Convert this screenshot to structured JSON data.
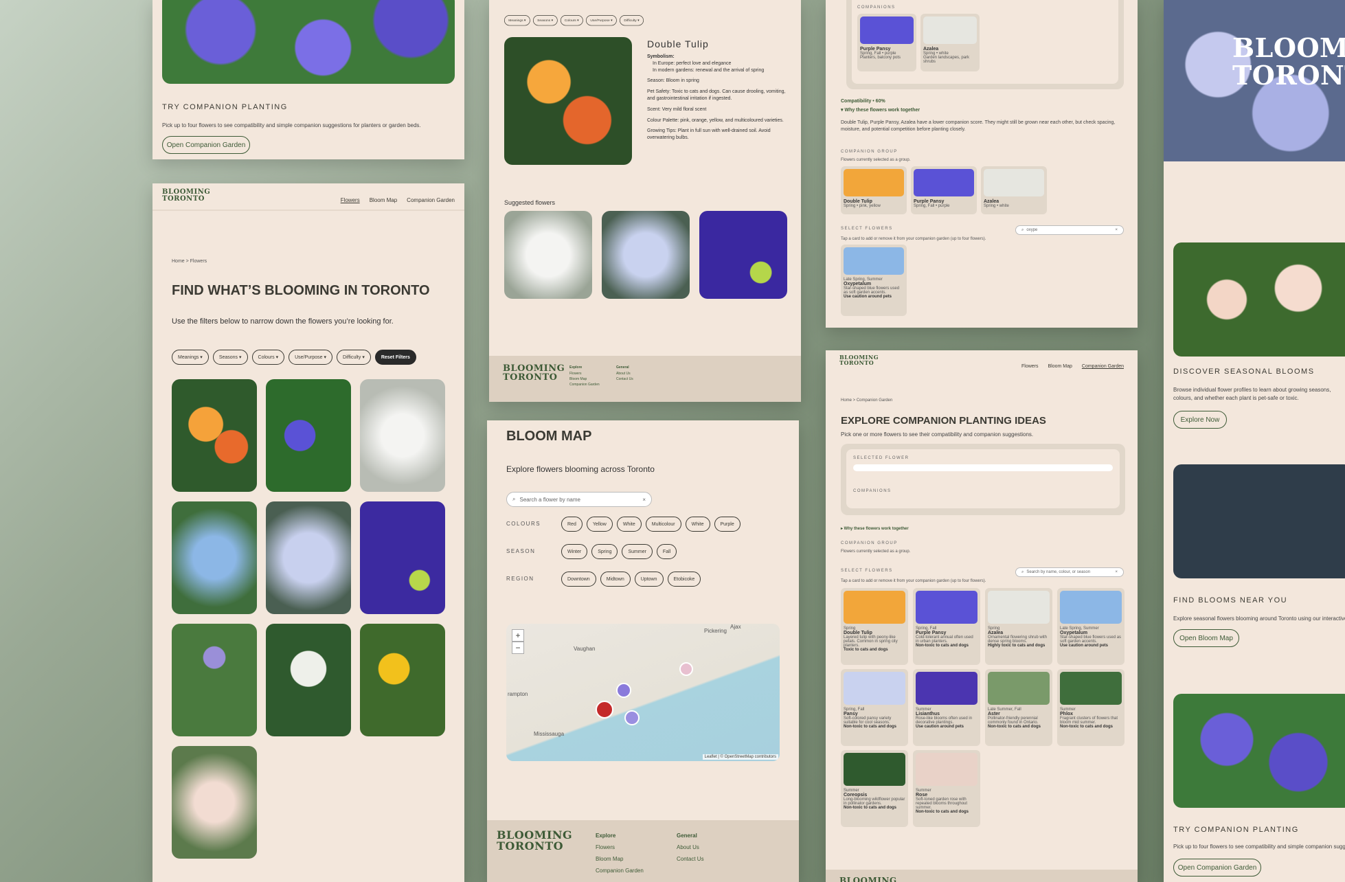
{
  "brand": {
    "line1": "BLOOMING",
    "line2": "TORONTO"
  },
  "nav": {
    "flowers": "Flowers",
    "bloom_map": "Bloom Map",
    "companion": "Companion Garden"
  },
  "panelA": {
    "heading": "TRY COMPANION PLANTING",
    "text": "Pick up to four flowers to see compatibility and simple companion suggestions for planters or garden beds.",
    "button": "Open Companion Garden"
  },
  "flowers_page": {
    "breadcrumb": "Home > Flowers",
    "title": "FIND WHAT’S BLOOMING IN TORONTO",
    "subtitle": "Use the filters below to narrow down the flowers you’re looking for.",
    "filters": [
      "Meanings ▾",
      "Seasons ▾",
      "Colours ▾",
      "Use/Purpose ▾",
      "Difficulty ▾"
    ],
    "reset": "Reset Filters"
  },
  "detail": {
    "filters": [
      "Meanings ▾",
      "Seasons ▾",
      "Colours ▾",
      "Use/Purpose ▾",
      "Difficulty ▾"
    ],
    "name": "Double Tulip",
    "symbolism_label": "Symbolism:",
    "symbolism": [
      "In Europe: perfect love and elegance",
      "In modern gardens: renewal and the arrival of spring"
    ],
    "season": "Season: Bloom in spring",
    "pet": "Pet Safety: Toxic to cats and dogs. Can cause drooling, vomiting, and gastrointestinal irritation if ingested.",
    "scent": "Scent: Very mild floral scent",
    "palette": "Colour Palette: pink, orange, yellow, and multicoloured varieties.",
    "tips": "Growing Tips: Plant in full sun with well-drained soil. Avoid overwatering bulbs.",
    "suggested": "Suggested flowers"
  },
  "footer": {
    "explore": "Explore",
    "general": "General",
    "links_explore": [
      "Flowers",
      "Bloom Map",
      "Companion Garden"
    ],
    "links_general": [
      "About Us",
      "Contact Us"
    ]
  },
  "bloommap": {
    "title": "BLOOM MAP",
    "subtitle": "Explore flowers blooming across Toronto",
    "search_placeholder": "Search a flower by name",
    "colours_label": "COLOURS",
    "colours": [
      "Red",
      "Yellow",
      "White",
      "Multicolour",
      "White",
      "Purple"
    ],
    "season_label": "SEASON",
    "seasons": [
      "Winter",
      "Spring",
      "Summer",
      "Fall"
    ],
    "region_label": "REGION",
    "regions": [
      "Downtown",
      "Midtown",
      "Uptown",
      "Etobicoke"
    ],
    "map_places": [
      "Vaughan",
      "Pickering",
      "Mississauga",
      "rampton",
      "Ajax"
    ],
    "attribution": "Leaflet | © OpenStreetMap contributors"
  },
  "comp_top": {
    "companions_label": "COMPANIONS",
    "comp1_name": "Purple Pansy",
    "comp1_meta": "Spring, Fall • purple",
    "comp1_desc": "Planters, balcony pots",
    "comp2_name": "Azalea",
    "comp2_meta": "Spring • white",
    "comp2_desc": "Garden landscapes, park shrubs",
    "compat": "Compatibility • 60%",
    "why": "▾ Why these flowers work together",
    "why_text": "Double Tulip, Purple Pansy, Azalea have a lower companion score. They might still be grown near each other, but check spacing, moisture, and potential competition before planting closely.",
    "group_label": "COMPANION GROUP",
    "group_text": "Flowers currently selected as a group.",
    "group": [
      {
        "name": "Double Tulip",
        "meta": "Spring • pink, yellow"
      },
      {
        "name": "Purple Pansy",
        "meta": "Spring, Fall • purple"
      },
      {
        "name": "Azalea",
        "meta": "Spring • white"
      }
    ],
    "select_label": "SELECT FLOWERS",
    "select_text": "Tap a card to add or remove it from your companion garden (up to four flowers).",
    "search_value": "oxype",
    "result": {
      "season": "Late Spring, Summer",
      "name": "Oxypetalum",
      "desc": "Star-shaped blue flowers used as soft garden accents.",
      "tox": "Use caution around pets"
    }
  },
  "comp_page": {
    "breadcrumb": "Home > Companion Garden",
    "title": "EXPLORE COMPANION PLANTING IDEAS",
    "subtitle": "Pick one or more flowers to see their compatibility and companion suggestions.",
    "selected_label": "SELECTED FLOWER",
    "companions_label": "COMPANIONS",
    "why": "▸ Why these flowers work together",
    "group_label": "COMPANION GROUP",
    "group_text": "Flowers currently selected as a group.",
    "select_label": "SELECT FLOWERS",
    "select_text": "Tap a card to add or remove it from your companion garden (up to four flowers).",
    "search_placeholder": "Search by name, colour, or season",
    "cards": [
      {
        "season": "Spring",
        "name": "Double Tulip",
        "desc": "Layered tulip with peony-like petals. Common in spring city planters.",
        "tox": "Toxic to cats and dogs"
      },
      {
        "season": "Spring, Fall",
        "name": "Purple Pansy",
        "desc": "Cold-tolerant annual often used in urban planters.",
        "tox": "Non-toxic to cats and dogs"
      },
      {
        "season": "Spring",
        "name": "Azalea",
        "desc": "Ornamental flowering shrub with dense spring blooms.",
        "tox": "Highly toxic to cats and dogs"
      },
      {
        "season": "Late Spring, Summer",
        "name": "Oxypetalum",
        "desc": "Star-shaped blue flowers used as soft garden accents.",
        "tox": "Use caution around pets"
      },
      {
        "season": "Spring, Fall",
        "name": "Pansy",
        "desc": "Soft-colored pansy variety suitable for cool seasons.",
        "tox": "Non-toxic to cats and dogs"
      },
      {
        "season": "Summer",
        "name": "Lisianthus",
        "desc": "Rose-like blooms often used in decorative plantings.",
        "tox": "Use caution around pets"
      },
      {
        "season": "Late Summer, Fall",
        "name": "Aster",
        "desc": "Pollinator-friendly perennial commonly found in Ontario.",
        "tox": "Non-toxic to cats and dogs"
      },
      {
        "season": "Summer",
        "name": "Phlox",
        "desc": "Fragrant clusters of flowers that bloom mid summer.",
        "tox": "Non-toxic to cats and dogs"
      },
      {
        "season": "Summer",
        "name": "Coreopsis",
        "desc": "Long-blooming wildflower popular in pollinator gardens.",
        "tox": "Non-toxic to cats and dogs"
      },
      {
        "season": "Summer",
        "name": "Rose",
        "desc": "Soft-toned garden rose with repeated blooms throughout summer.",
        "tox": "Non-toxic to cats and dogs"
      }
    ]
  },
  "right": {
    "hero": "BLOOMING TORONTO",
    "s1_title": "DISCOVER SEASONAL BLOOMS",
    "s1_text": "Browse individual flower profiles to learn about growing seasons, colours, and whether each plant is pet-safe or toxic.",
    "s1_btn": "Explore Now",
    "s2_title": "FIND BLOOMS NEAR YOU",
    "s2_text": "Explore seasonal flowers blooming around Toronto using our interactive map.",
    "s2_btn": "Open Bloom Map",
    "s3_title": "TRY COMPANION PLANTING",
    "s3_text": "Pick up to four flowers to see compatibility and simple companion suggestions.",
    "s3_btn": "Open Companion Garden"
  }
}
